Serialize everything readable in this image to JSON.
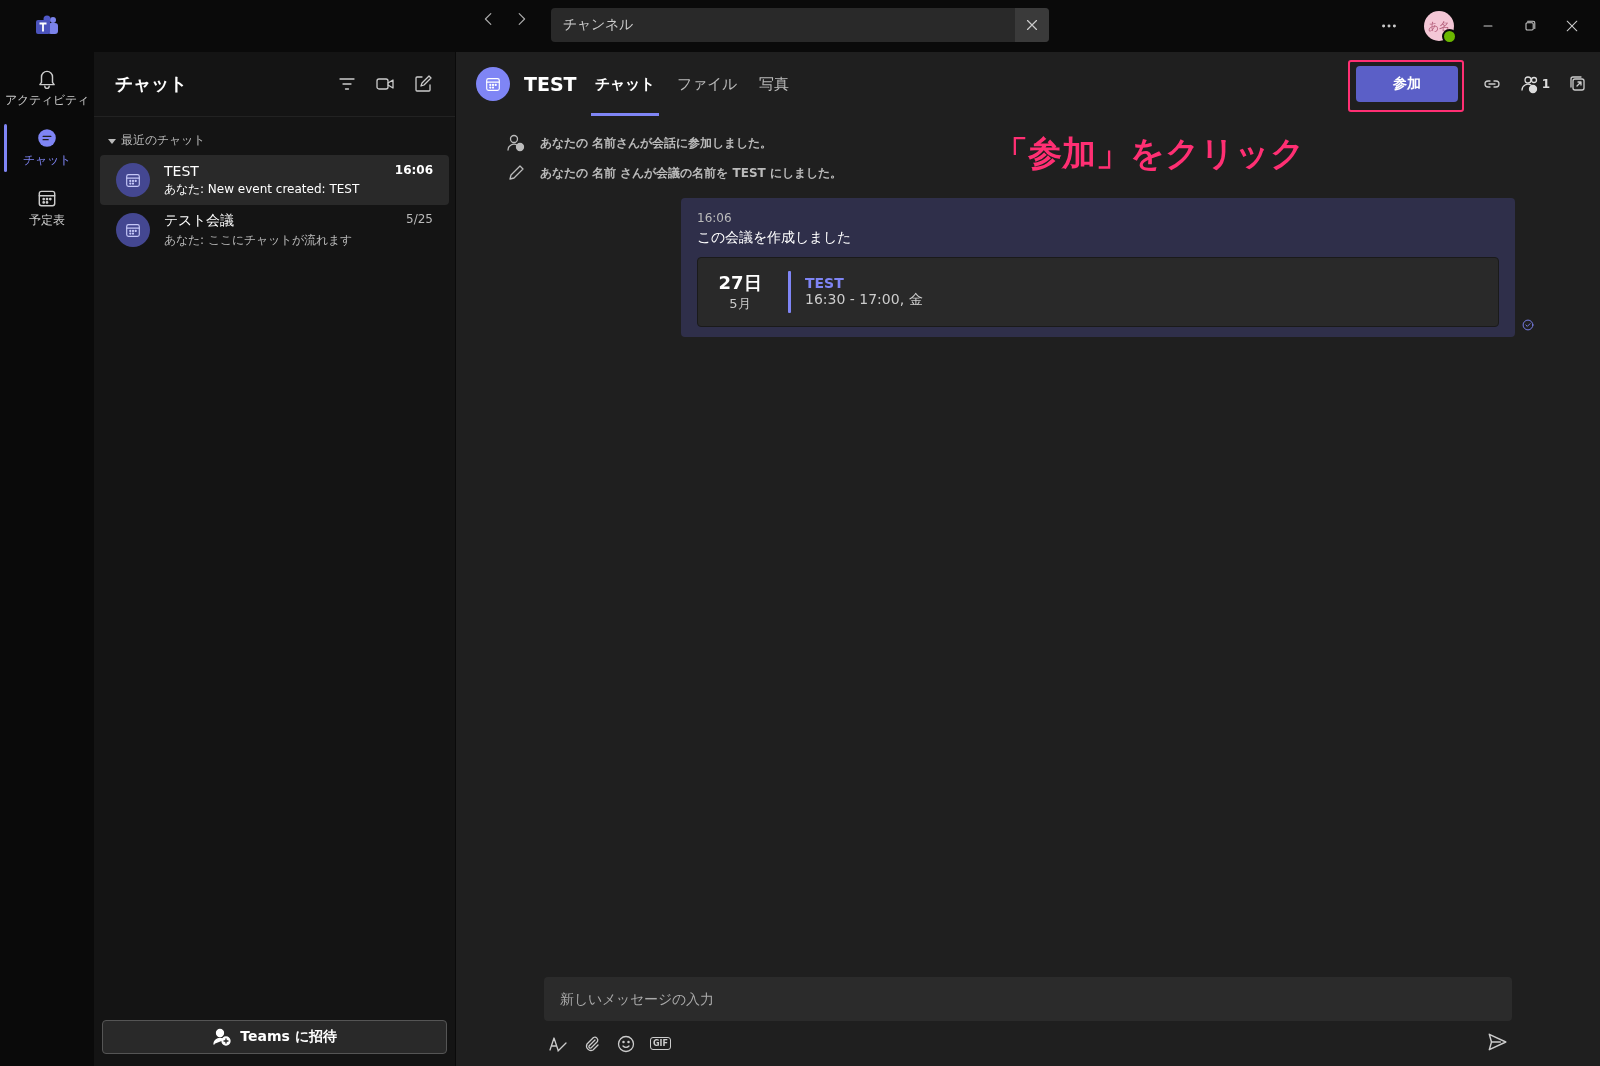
{
  "title_bar": {
    "search": {
      "value": "チャンネル"
    },
    "avatar": {
      "initials": "あ名"
    }
  },
  "rail": [
    {
      "label": "アクティビティ",
      "kind": "bell",
      "selected": false
    },
    {
      "label": "チャット",
      "kind": "chat",
      "selected": true
    },
    {
      "label": "予定表",
      "kind": "calendar",
      "selected": false
    }
  ],
  "chat_list": {
    "title": "チャット",
    "section": "最近のチャット",
    "items": [
      {
        "name": "TEST",
        "preview": "あなた: New event created: TEST",
        "time": "16:06",
        "selected": true,
        "unread": true
      },
      {
        "name": "テスト会議",
        "preview": "あなた: ここにチャットが流れます",
        "time": "5/25",
        "selected": false,
        "unread": false
      }
    ],
    "invite_button": "Teams に招待"
  },
  "conversation": {
    "title": "TEST",
    "tabs": [
      {
        "label": "チャット",
        "selected": true
      },
      {
        "label": "ファイル",
        "selected": false
      },
      {
        "label": "写真",
        "selected": false
      }
    ],
    "join_button": "参加",
    "participants": "1",
    "annotation": "「参加」をクリック",
    "system_messages": [
      {
        "kind": "joined",
        "text": "あなたの 名前さんが会話に参加しました。"
      },
      {
        "kind": "renamed",
        "text": "あなたの 名前 さんが会議の名前を TEST にしました。"
      }
    ],
    "message": {
      "time": "16:06",
      "text": "この会議を作成しました",
      "event": {
        "day": "27日",
        "month": "5月",
        "title": "TEST",
        "time": "16:30 - 17:00, 金"
      }
    },
    "composer": {
      "placeholder": "新しいメッセージの入力",
      "gif": "GIF"
    }
  }
}
